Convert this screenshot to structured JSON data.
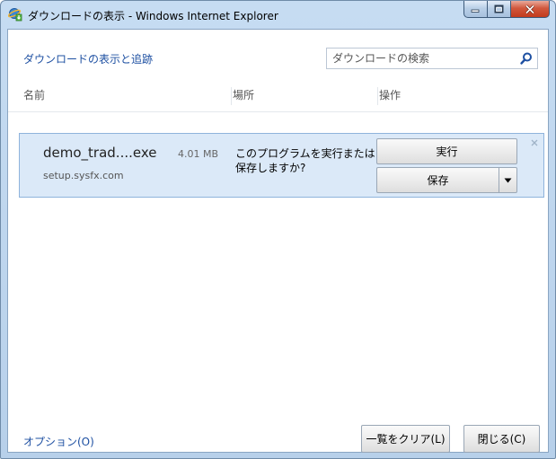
{
  "window": {
    "title": "ダウンロードの表示 - Windows Internet Explorer",
    "icon": "ie-download-icon"
  },
  "header": {
    "link_label": "ダウンロードの表示と追跡",
    "search": {
      "placeholder": "ダウンロードの検索",
      "value": "",
      "icon": "search-icon"
    }
  },
  "columns": {
    "name": "名前",
    "location": "場所",
    "actions": "操作"
  },
  "downloads": [
    {
      "filename": "demo_trad....exe",
      "size": "4.01 MB",
      "source": "setup.sysfx.com",
      "prompt": "このプログラムを実行または保存しますか?",
      "run_label": "実行",
      "save_label": "保存"
    }
  ],
  "footer": {
    "options_label": "オプション(O)",
    "clear_label": "一覧をクリア(L)",
    "close_label": "閉じる(C)"
  },
  "colors": {
    "link": "#1e50a2",
    "row_highlight": "#dbe9f8",
    "row_border": "#8fb3dc",
    "close_button": "#c23b1d"
  }
}
